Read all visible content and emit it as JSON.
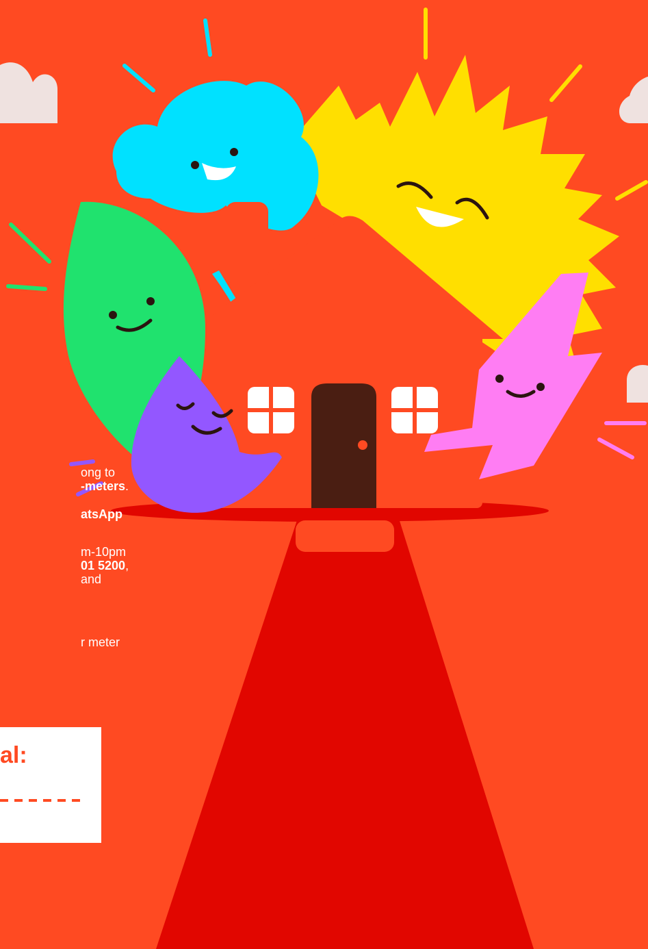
{
  "colors": {
    "background": "#FF4A22",
    "path": "#E10600",
    "house": "#FF4A22",
    "door": "#4A1E12",
    "cloud": "#00E1FF",
    "sun": "#FFDF00",
    "leaf": "#20E26E",
    "drop": "#9357FF",
    "bolt": "#FF7DF3",
    "window": "#FFFFFF",
    "side_clouds": "#EFE2E0",
    "card": "#FFFFFF",
    "card_text": "#FF4A22"
  },
  "illustration": {
    "characters": [
      "cloud-character",
      "sun-character",
      "leaf-character",
      "water-drop-character",
      "lightning-bolt-character"
    ],
    "scene": "house-with-red-path"
  },
  "text_fragments": {
    "line1": "ong to",
    "line2": "-meters",
    "line2_suffix": ".",
    "line3": "atsApp",
    "line4": "m-10pm",
    "line5": "01 5200",
    "line5_suffix": ",",
    "line6": "and",
    "line7": "r meter"
  },
  "card": {
    "heading": "al:"
  }
}
